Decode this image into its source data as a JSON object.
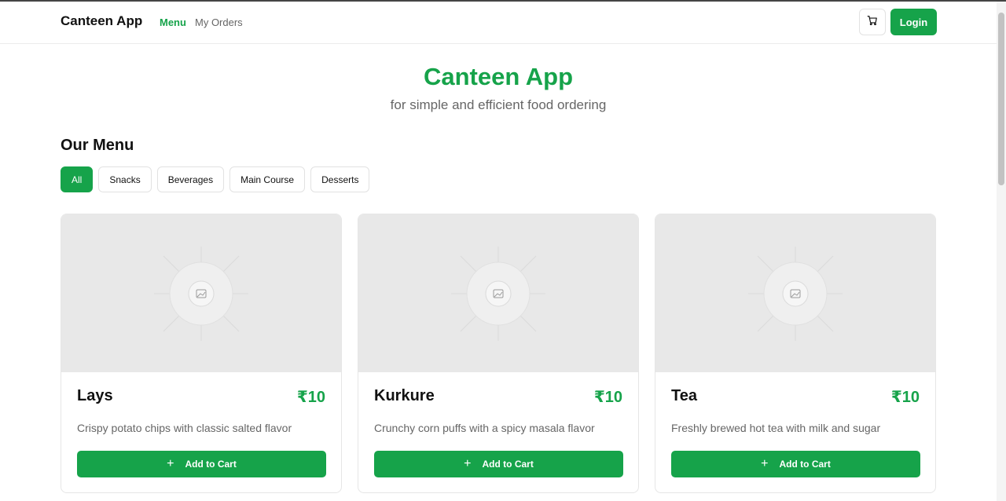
{
  "nav": {
    "brand": "Canteen App",
    "links": [
      {
        "label": "Menu",
        "active": true
      },
      {
        "label": "My Orders",
        "active": false
      }
    ],
    "cart_icon": "shopping-cart-icon",
    "login_label": "Login"
  },
  "hero": {
    "title": "Canteen App",
    "subtitle": "for simple and efficient food ordering"
  },
  "menu": {
    "title": "Our Menu",
    "filters": [
      {
        "label": "All",
        "active": true
      },
      {
        "label": "Snacks",
        "active": false
      },
      {
        "label": "Beverages",
        "active": false
      },
      {
        "label": "Main Course",
        "active": false
      },
      {
        "label": "Desserts",
        "active": false
      }
    ],
    "items": [
      {
        "name": "Lays",
        "price": "₹10",
        "description": "Crispy potato chips with classic salted flavor",
        "button": "Add to Cart"
      },
      {
        "name": "Kurkure",
        "price": "₹10",
        "description": "Crunchy corn puffs with a spicy masala flavor",
        "button": "Add to Cart"
      },
      {
        "name": "Tea",
        "price": "₹10",
        "description": "Freshly brewed hot tea with milk and sugar",
        "button": "Add to Cart"
      }
    ]
  },
  "colors": {
    "accent": "#16a34a",
    "placeholder_bg": "#e8e8e8",
    "muted_text": "#666666"
  }
}
